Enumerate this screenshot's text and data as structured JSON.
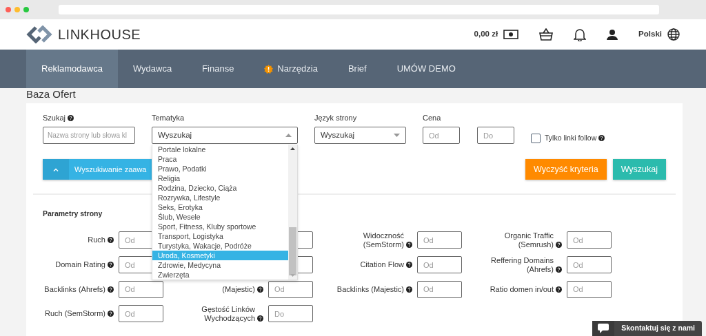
{
  "header": {
    "logo": "LINKHOUSE",
    "balance": "0,00 zł",
    "language": "Polski"
  },
  "nav": [
    {
      "label": "Reklamodawca",
      "selected": true,
      "alert": false
    },
    {
      "label": "Wydawca",
      "selected": false,
      "alert": false
    },
    {
      "label": "Finanse",
      "selected": false,
      "alert": false
    },
    {
      "label": "Narzędzia",
      "selected": false,
      "alert": true
    },
    {
      "label": "Brief",
      "selected": false,
      "alert": false
    },
    {
      "label": "UMÓW DEMO",
      "selected": false,
      "alert": false
    }
  ],
  "page_title": "Baza Ofert",
  "filters": {
    "search": {
      "label": "Szukaj",
      "help": true,
      "placeholder": "Nazwa strony lub słowa kl"
    },
    "topic": {
      "label": "Tematyka",
      "value": "Wyszukaj",
      "expanded": true
    },
    "language": {
      "label": "Język strony",
      "value": "Wyszukaj"
    },
    "price": {
      "label": "Cena",
      "from_placeholder": "Od",
      "to_placeholder": "Do"
    },
    "follow_only": {
      "label": "Tylko linki follow",
      "help": true,
      "checked": false
    }
  },
  "topic_options": [
    {
      "label": "Portale lokalne",
      "selected": false
    },
    {
      "label": "Praca",
      "selected": false
    },
    {
      "label": "Prawo, Podatki",
      "selected": false
    },
    {
      "label": "Religia",
      "selected": false
    },
    {
      "label": "Rodzina, Dziecko, Ciąża",
      "selected": false
    },
    {
      "label": "Rozrywka, Lifestyle",
      "selected": false
    },
    {
      "label": "Seks, Erotyka",
      "selected": false
    },
    {
      "label": "Ślub, Wesele",
      "selected": false
    },
    {
      "label": "Sport, Fitness, Kluby sportowe",
      "selected": false
    },
    {
      "label": "Transport, Logistyka",
      "selected": false
    },
    {
      "label": "Turystyka, Wakacje, Podróże",
      "selected": false
    },
    {
      "label": "Uroda, Kosmetyki",
      "selected": true
    },
    {
      "label": "Zdrowie, Medycyna",
      "selected": false
    },
    {
      "label": "Zwierzęta",
      "selected": false
    }
  ],
  "advanced_search": {
    "label": "Wyszukiwanie zaawa",
    "expanded": true
  },
  "buttons": [
    {
      "label": "Wyczyść kryteria",
      "kind": "clear"
    },
    {
      "label": "Wyszukaj",
      "kind": "search"
    }
  ],
  "params_title": "Parametry strony",
  "params": [
    {
      "label": "Ruch",
      "help": true,
      "kind": "field",
      "placeholder": "Od"
    },
    {
      "kind": "blank_field"
    },
    {
      "label": "Widoczność (SemStorm)",
      "help": true,
      "kind": "field",
      "placeholder": "Od"
    },
    {
      "label": "Organic Traffic (Semrush)",
      "help": true,
      "kind": "field",
      "placeholder": "Od"
    },
    {
      "label": "Domain Rating",
      "help": true,
      "kind": "field",
      "placeholder": "Od"
    },
    {
      "kind": "blank_field"
    },
    {
      "label": "Citation Flow",
      "help": true,
      "kind": "field",
      "placeholder": "Od"
    },
    {
      "label": "Reffering Domains (Ahrefs)",
      "help": true,
      "kind": "field",
      "placeholder": "Od"
    },
    {
      "label": "Backlinks (Ahrefs)",
      "help": true,
      "kind": "field",
      "placeholder": "Od"
    },
    {
      "label": "(Majestic)",
      "help": true,
      "kind": "field",
      "placeholder": "Od"
    },
    {
      "label": "Backlinks (Majestic)",
      "help": true,
      "kind": "field",
      "placeholder": "Od"
    },
    {
      "label": "Ratio domen in/out",
      "help": true,
      "kind": "field",
      "placeholder": "Od"
    },
    {
      "label": "Ruch (SemStorm)",
      "help": true,
      "kind": "field",
      "placeholder": "Od"
    },
    {
      "label": "Gęstość Linków Wychodzących",
      "help": true,
      "kind": "field",
      "placeholder": "Do"
    }
  ],
  "chat_widget": {
    "label": "Skontaktuj się z nami"
  }
}
